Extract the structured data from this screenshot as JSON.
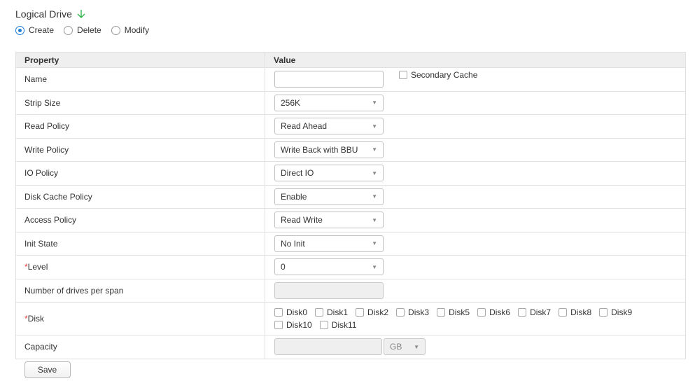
{
  "header": {
    "title": "Logical Drive",
    "radios": [
      {
        "label": "Create",
        "checked": true
      },
      {
        "label": "Delete",
        "checked": false
      },
      {
        "label": "Modify",
        "checked": false
      }
    ]
  },
  "table": {
    "col_property": "Property",
    "col_value": "Value",
    "rows": {
      "name": {
        "label": "Name",
        "value": "",
        "secondary_cache_label": "Secondary Cache"
      },
      "strip_size": {
        "label": "Strip Size",
        "value": "256K"
      },
      "read_policy": {
        "label": "Read Policy",
        "value": "Read Ahead"
      },
      "write_policy": {
        "label": "Write Policy",
        "value": "Write Back with BBU"
      },
      "io_policy": {
        "label": "IO Policy",
        "value": "Direct IO"
      },
      "disk_cache_policy": {
        "label": "Disk Cache Policy",
        "value": "Enable"
      },
      "access_policy": {
        "label": "Access Policy",
        "value": "Read Write"
      },
      "init_state": {
        "label": "Init State",
        "value": "No Init"
      },
      "level": {
        "required_mark": "*",
        "label": "Level",
        "value": "0"
      },
      "drives_per_span": {
        "label": "Number of drives per span",
        "value": ""
      },
      "disk": {
        "required_mark": "*",
        "label": "Disk",
        "disks": [
          "Disk0",
          "Disk1",
          "Disk2",
          "Disk3",
          "Disk5",
          "Disk6",
          "Disk7",
          "Disk8",
          "Disk9",
          "Disk10",
          "Disk11"
        ]
      },
      "capacity": {
        "label": "Capacity",
        "value": "",
        "unit": "GB"
      }
    }
  },
  "save_label": "Save",
  "colors": {
    "accent": "#1c7cd6",
    "required": "#e23b3b",
    "arrow": "#34b34f"
  }
}
